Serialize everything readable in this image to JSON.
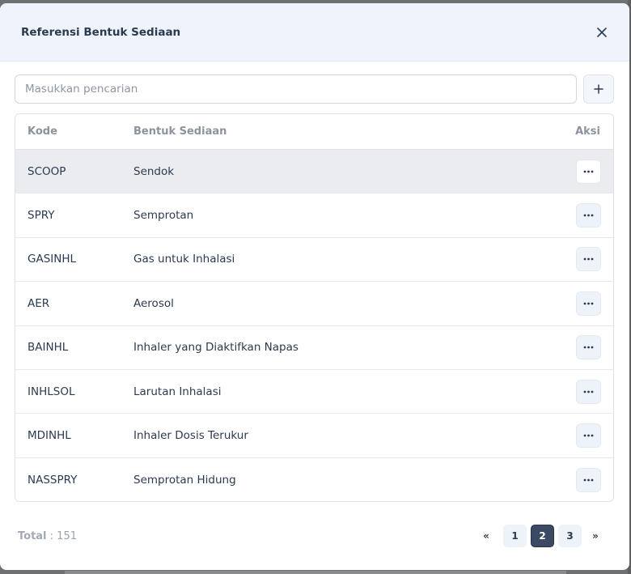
{
  "modal": {
    "title": "Referensi Bentuk Sediaan"
  },
  "search": {
    "placeholder": "Masukkan pencarian",
    "value": ""
  },
  "table": {
    "headers": {
      "kode": "Kode",
      "bentuk": "Bentuk Sediaan",
      "aksi": "Aksi"
    },
    "rows": [
      {
        "kode": "SCOOP",
        "bentuk": "Sendok",
        "active": true
      },
      {
        "kode": "SPRY",
        "bentuk": "Semprotan"
      },
      {
        "kode": "GASINHL",
        "bentuk": "Gas untuk Inhalasi"
      },
      {
        "kode": "AER",
        "bentuk": "Aerosol"
      },
      {
        "kode": "BAINHL",
        "bentuk": "Inhaler yang Diaktifkan Napas"
      },
      {
        "kode": "INHLSOL",
        "bentuk": "Larutan Inhalasi"
      },
      {
        "kode": "MDINHL",
        "bentuk": "Inhaler Dosis Terukur"
      },
      {
        "kode": "NASSPRY",
        "bentuk": "Semprotan Hidung"
      }
    ]
  },
  "footer": {
    "total_label": "Total",
    "total_sep": " : ",
    "total_value": "151",
    "pagination": {
      "first": "«",
      "last": "»",
      "pages": [
        "1",
        "2",
        "3"
      ],
      "current": "2"
    }
  },
  "colors": {
    "header_bg": "#eef3fc",
    "active_row": "#ebecef",
    "page_current": "#3b4a62",
    "text": "#2c3a4f"
  },
  "icons": {
    "close": "close-icon",
    "add": "plus-icon",
    "more": "more-horizontal-icon"
  }
}
